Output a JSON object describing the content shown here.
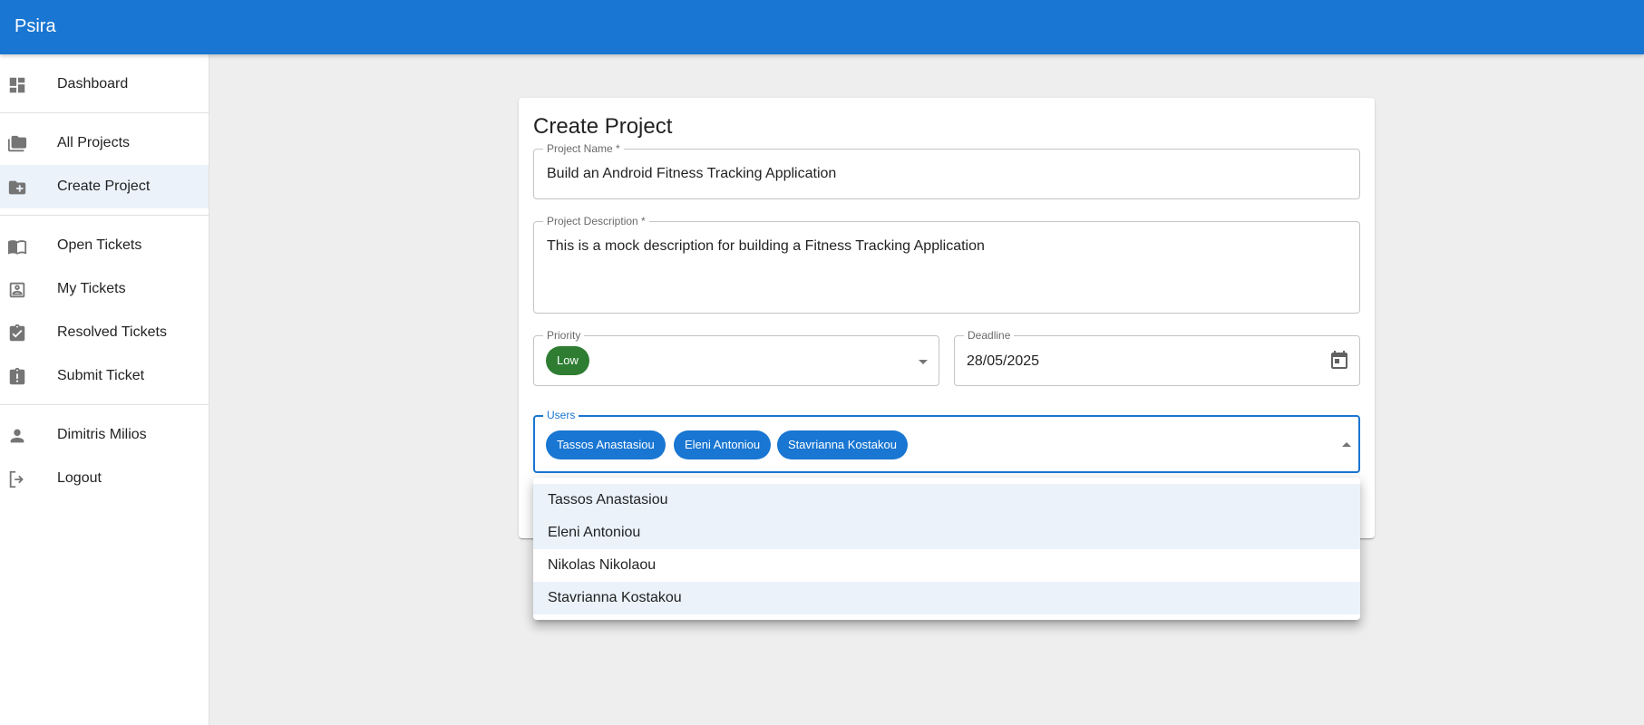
{
  "app": {
    "title": "Psira"
  },
  "sidebar": {
    "items": [
      {
        "label": "Dashboard",
        "icon": "dashboard-icon"
      },
      {
        "label": "All Projects",
        "icon": "folders-icon"
      },
      {
        "label": "Create Project",
        "icon": "create-folder-icon",
        "active": true
      },
      {
        "label": "Open Tickets",
        "icon": "open-book-icon"
      },
      {
        "label": "My Tickets",
        "icon": "contact-page-icon"
      },
      {
        "label": "Resolved Tickets",
        "icon": "assignment-check-icon"
      },
      {
        "label": "Submit Ticket",
        "icon": "assignment-late-icon"
      },
      {
        "label": "Dimitris Milios",
        "icon": "person-icon"
      },
      {
        "label": "Logout",
        "icon": "logout-icon"
      }
    ]
  },
  "form": {
    "title": "Create Project",
    "project_name": {
      "label": "Project Name *",
      "value": "Build an Android Fitness Tracking Application"
    },
    "project_description": {
      "label": "Project Description *",
      "value": "This is a mock description for building a Fitness Tracking Application"
    },
    "priority": {
      "label": "Priority",
      "value": "Low",
      "color": "#2e7d32"
    },
    "deadline": {
      "label": "Deadline",
      "value": "28/05/2025"
    },
    "users": {
      "label": "Users",
      "selected": [
        "Tassos Anastasiou",
        "Eleni Antoniou",
        "Stavrianna Kostakou"
      ],
      "options": [
        {
          "label": "Tassos Anastasiou",
          "selected": true
        },
        {
          "label": "Eleni Antoniou",
          "selected": true
        },
        {
          "label": "Nikolas Nikolaou",
          "selected": false
        },
        {
          "label": "Stavrianna Kostakou",
          "selected": true
        }
      ]
    }
  },
  "colors": {
    "primary": "#1976d2",
    "selected_bg": "#ebf2fa",
    "page_bg": "#eeeeee"
  }
}
